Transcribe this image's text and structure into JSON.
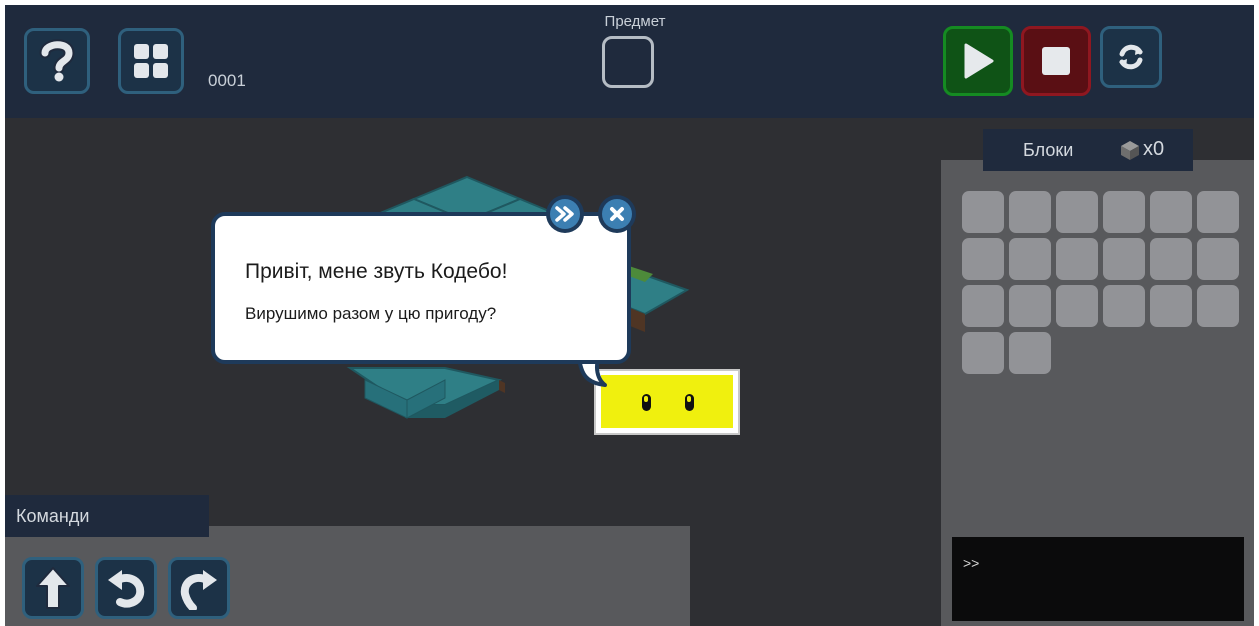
{
  "toolbar": {
    "help_icon": "question-icon",
    "levels_icon": "grid-icon",
    "level_number": "0001",
    "item_label": "Предмет",
    "run_icon": "play-icon",
    "stop_icon": "stop-icon",
    "reset_icon": "refresh-icon",
    "colors": {
      "run": "#158b22",
      "stop": "#8f1720",
      "default": "#2f607d"
    }
  },
  "dialog": {
    "title": "Привіт, мене звуть Кодебо!",
    "text": "Вирушимо разом у цю пригоду?",
    "next_icon": "double-chevron-right-icon",
    "close_icon": "close-icon"
  },
  "blocks": {
    "title": "Блоки",
    "count": "x0",
    "count_icon": "cube-icon",
    "slot_count": 20
  },
  "console": {
    "prompt": ">>"
  },
  "commands": {
    "title": "Команди",
    "items": [
      {
        "name": "move-forward",
        "icon": "arrow-up-icon"
      },
      {
        "name": "turn-left",
        "icon": "rotate-left-icon"
      },
      {
        "name": "turn-right",
        "icon": "rotate-right-icon"
      }
    ]
  }
}
